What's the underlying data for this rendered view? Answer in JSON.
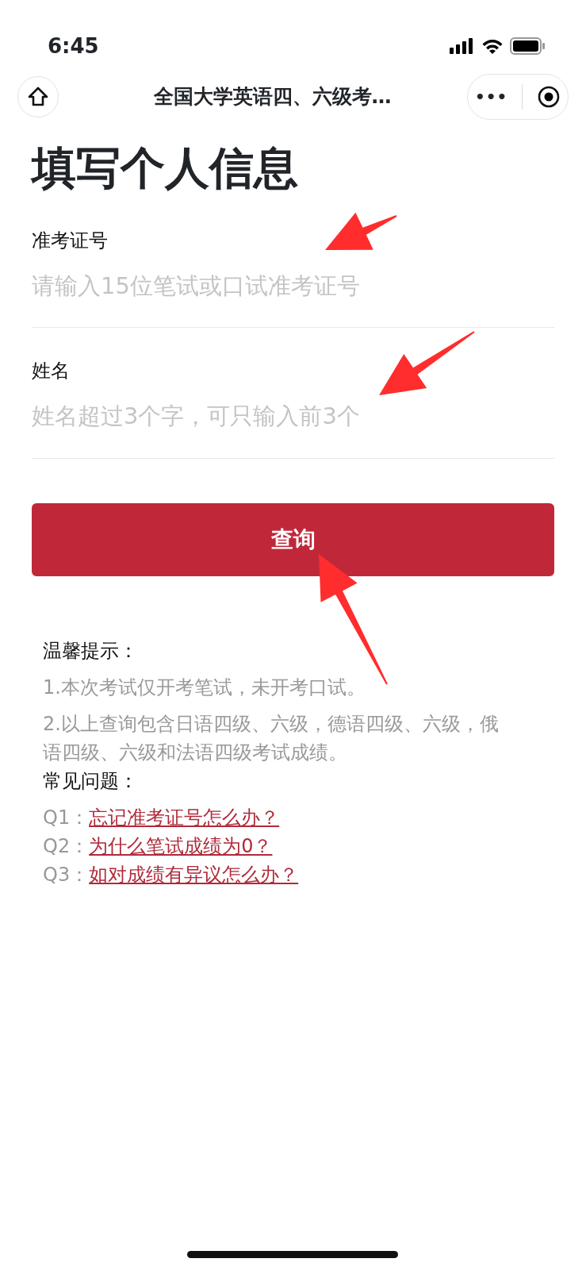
{
  "status_bar": {
    "time": "6:45"
  },
  "nav": {
    "title": "全国大学英语四、六级考…",
    "menu": "•••"
  },
  "heading": "填写个人信息",
  "fields": [
    {
      "label": "准考证号",
      "placeholder": "请输入15位笔试或口试准考证号"
    },
    {
      "label": "姓名",
      "placeholder": "姓名超过3个字，可只输入前3个"
    }
  ],
  "submit": "查询",
  "tips": {
    "title": "温馨提示：",
    "items": [
      "1.本次考试仅开考笔试，未开考口试。",
      "2.以上查询包含日语四级、六级，德语四级、六级，俄语四级、六级和法语四级考试成绩。"
    ]
  },
  "faq": {
    "title": "常见问题：",
    "items": [
      {
        "label": "Q1：",
        "link": "忘记准考证号怎么办？"
      },
      {
        "label": "Q2：",
        "link": "为什么笔试成绩为0？"
      },
      {
        "label": "Q3：",
        "link": "如对成绩有异议怎么办？"
      }
    ]
  },
  "annotations": [
    {
      "kind": "arrow"
    },
    {
      "kind": "arrow"
    },
    {
      "kind": "arrow"
    }
  ]
}
